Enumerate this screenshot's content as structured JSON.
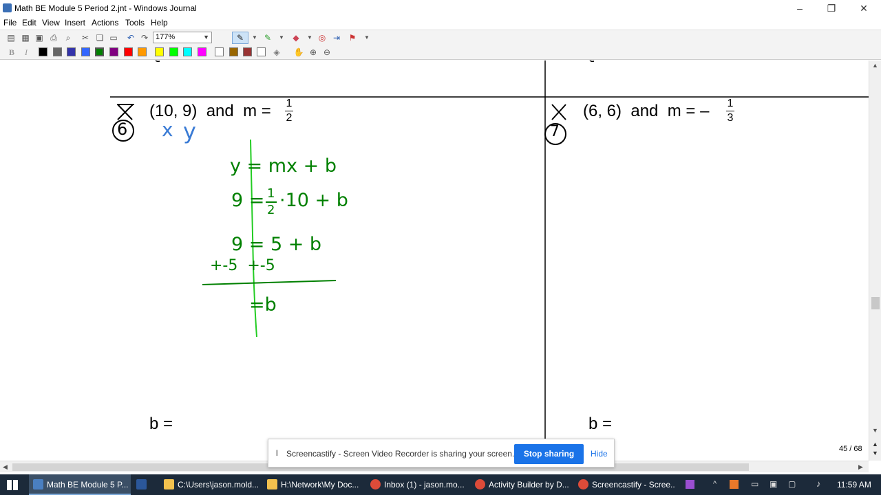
{
  "window": {
    "title": "Math BE Module 5 Period 2.jnt - Windows Journal"
  },
  "menu": [
    "File",
    "Edit",
    "View",
    "Insert",
    "Actions",
    "Tools",
    "Help"
  ],
  "toolbar": {
    "zoom": "177%"
  },
  "colors": [
    "#000000",
    "#666666",
    "#3333aa",
    "#3366ff",
    "#008000",
    "#800080",
    "#ff0000",
    "#ff9900",
    "#ffff00",
    "#00ff00",
    "#00ffff",
    "#ff00ff",
    "#ffffff",
    "#996600",
    "#993333",
    "#ffffff"
  ],
  "problems": {
    "left": {
      "text": "(10, 9)  and  m = ",
      "num": "1",
      "den": "2",
      "answer": "b ="
    },
    "right": {
      "text": "(6, 6)  and  m = –",
      "num": "1",
      "den": "3",
      "answer": "b ="
    }
  },
  "ink": {
    "labels": [
      "x",
      "y"
    ],
    "step1": "y = mx + b",
    "step2_lead": "9 = ",
    "step2_num": "1",
    "step2_den": "2",
    "step2_tail": "·10 + b",
    "step3": "9 = 5 + b",
    "step4": "+-5  +-5",
    "step5": "=b",
    "num_left": "6",
    "num_right": "7"
  },
  "toast": {
    "message": "Screencastify - Screen Video Recorder is sharing your screen.",
    "stop": "Stop sharing",
    "hide": "Hide"
  },
  "page_indicator": "45 / 68",
  "taskbar": {
    "items": [
      {
        "label": "Math BE Module 5 P...",
        "color": "#4a7fc1"
      },
      {
        "label": "",
        "color": "#2b579a"
      },
      {
        "label": "C:\\Users\\jason.mold...",
        "color": "#f2c14e"
      },
      {
        "label": "H:\\Network\\My Doc...",
        "color": "#f2c14e"
      },
      {
        "label": "Inbox (1) - jason.mo...",
        "color": "#dd4b39"
      },
      {
        "label": "Activity Builder by D...",
        "color": "#dd4b39"
      },
      {
        "label": "Screencastify - Scree...",
        "color": "#dd4b39"
      }
    ],
    "clock": "11:59 AM"
  }
}
